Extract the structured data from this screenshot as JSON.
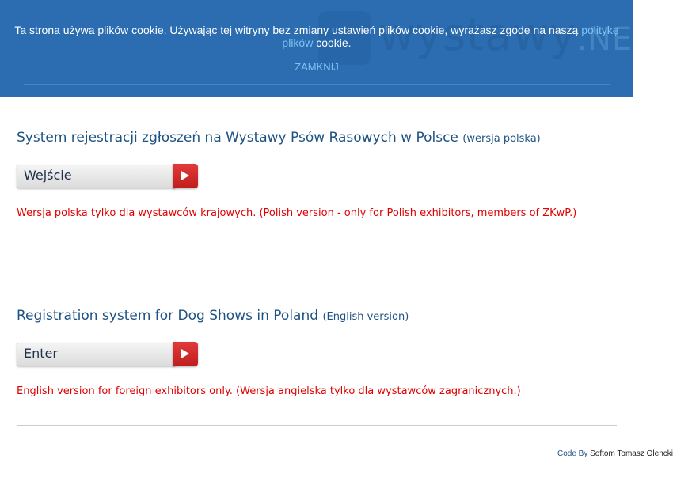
{
  "header": {
    "logo_text": "wystawy",
    "logo_tld": ".NET"
  },
  "cookie_banner": {
    "text_before": "Ta strona używa plików cookie. Używając tej witryny bez zmiany ustawień plików cookie, wyrażasz zgodę na naszą ",
    "policy_link": "politykę plików",
    "text_after": " cookie.",
    "close_label": "ZAMKNIJ"
  },
  "polish_section": {
    "title": "System rejestracji zgłoszeń na Wystawy Psów Rasowych w Polsce",
    "version": "(wersja polska)",
    "button_label": "Wejście",
    "note": "Wersja polska tylko dla wystawców krajowych. (Polish version - only for Polish exhibitors, members of ZKwP.)"
  },
  "english_section": {
    "title": "Registration system for Dog Shows in Poland",
    "version": "(English version)",
    "button_label": "Enter",
    "note": "English version for foreign exhibitors only. (Wersja angielska tylko dla wystawców zagranicznych.)"
  },
  "footer": {
    "code_by": "Code By",
    "author": "Softom Tomasz Olencki"
  },
  "colors": {
    "banner_bg": "#2b6db0",
    "link": "#7ec2f3",
    "title": "#1d5283",
    "note": "#e00000",
    "button_arrow": "#d12a2a"
  }
}
